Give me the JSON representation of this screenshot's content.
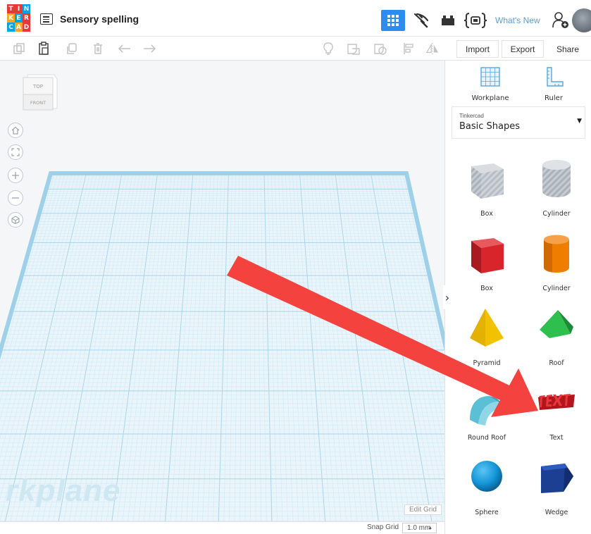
{
  "app": {
    "logo_letters": [
      "T",
      "I",
      "N",
      "K",
      "E",
      "R",
      "C",
      "A",
      "D"
    ],
    "logo_colors": [
      "#e53935",
      "#e53935",
      "#00a4e4",
      "#f5a623",
      "#00a4e4",
      "#e53935",
      "#00a4e4",
      "#f5a623",
      "#e53935"
    ],
    "document_title": "Sensory spelling",
    "whats_new": "What's New",
    "accent": "#2d8cf0"
  },
  "toolbar": {
    "import_label": "Import",
    "export_label": "Export",
    "share_label": "Share",
    "icons": [
      "copy-icon",
      "paste-icon",
      "duplicate-icon",
      "delete-icon",
      "undo-icon",
      "redo-icon",
      "note-icon",
      "group-icon",
      "ungroup-icon",
      "align-icon",
      "mirror-icon"
    ]
  },
  "viewport": {
    "viewcube_top": "TOP",
    "viewcube_front": "FRONT",
    "workplane_label": "rkplane",
    "edit_grid": "Edit Grid",
    "snap_grid_label": "Snap Grid",
    "snap_grid_value": "1.0 mm"
  },
  "panel": {
    "workplane_label": "Workplane",
    "ruler_label": "Ruler",
    "library_small": "Tinkercad",
    "library_name": "Basic Shapes",
    "shapes": [
      {
        "label": "Box",
        "color": "#b8bec6"
      },
      {
        "label": "Cylinder",
        "color": "#b8bec6"
      },
      {
        "label": "Box",
        "color": "#d8252b"
      },
      {
        "label": "Cylinder",
        "color": "#ef7d00"
      },
      {
        "label": "Pyramid",
        "color": "#f2c200"
      },
      {
        "label": "Roof",
        "color": "#26a641"
      },
      {
        "label": "Round Roof",
        "color": "#5bbfd6"
      },
      {
        "label": "Text",
        "color": "#d8252b"
      },
      {
        "label": "Sphere",
        "color": "#1496d8"
      },
      {
        "label": "Wedge",
        "color": "#1c3f94"
      }
    ]
  },
  "annotation": {
    "arrow_color": "#f4433f"
  }
}
